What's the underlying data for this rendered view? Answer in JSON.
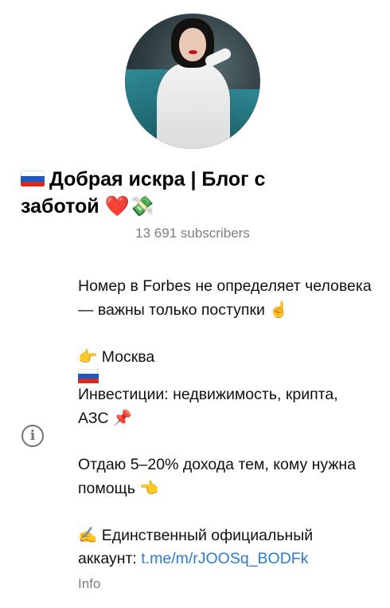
{
  "channel": {
    "name": "Добрая искра | Блог с заботой",
    "title_emoji": "❤️💸",
    "subscribers": "13 691 subscribers"
  },
  "about": {
    "line1": "Номер в Forbes не определяет человека — важны только поступки",
    "line1_emoji": "☝️",
    "city": "Москва",
    "city_emoji": "👉",
    "investments": "Инвестиции: недвижимость, крипта, АЗС",
    "investments_emoji": "📌",
    "help": "Отдаю 5–20% дохода тем, кому нужна помощь",
    "help_emoji": "👈",
    "official": "Единственный официальный аккаунт:",
    "official_emoji": "✍️",
    "link": "t.me/m/rJOOSq_BODFk"
  },
  "info_label": "Info",
  "colors": {
    "link": "#2a7bd4",
    "muted": "#7d7f82"
  }
}
